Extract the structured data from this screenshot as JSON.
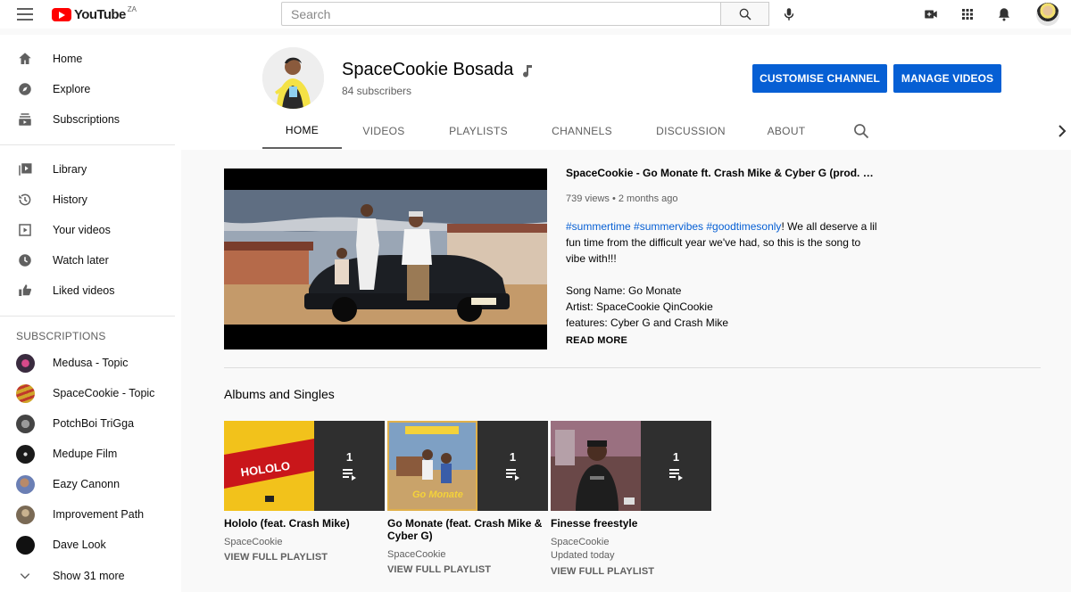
{
  "topbar": {
    "logo_text": "YouTube",
    "region": "ZA",
    "search_placeholder": "Search"
  },
  "sidebar": {
    "main": [
      {
        "label": "Home",
        "icon": "home-icon"
      },
      {
        "label": "Explore",
        "icon": "compass-icon"
      },
      {
        "label": "Subscriptions",
        "icon": "subscriptions-icon"
      }
    ],
    "library": [
      {
        "label": "Library",
        "icon": "library-icon"
      },
      {
        "label": "History",
        "icon": "history-icon"
      },
      {
        "label": "Your videos",
        "icon": "your-videos-icon"
      },
      {
        "label": "Watch later",
        "icon": "clock-icon"
      },
      {
        "label": "Liked videos",
        "icon": "thumbs-up-icon"
      }
    ],
    "subscriptions_heading": "SUBSCRIPTIONS",
    "subscriptions": [
      {
        "label": "Medusa - Topic",
        "color": "#3a2b3f"
      },
      {
        "label": "SpaceCookie - Topic",
        "color": "#d0a52a"
      },
      {
        "label": "PotchBoi TriGga",
        "color": "#555555"
      },
      {
        "label": "Medupe Film",
        "color": "#1a1a1a"
      },
      {
        "label": "Eazy Canonn",
        "color": "#6b7fb4"
      },
      {
        "label": "Improvement Path",
        "color": "#7a6a55"
      },
      {
        "label": "Dave Look",
        "color": "#111111"
      }
    ],
    "show_more": "Show 31 more"
  },
  "channel": {
    "name": "SpaceCookie Bosada",
    "subscribers": "84 subscribers",
    "customise_label": "CUSTOMISE CHANNEL",
    "manage_label": "MANAGE VIDEOS",
    "accent": "#065fd4",
    "tabs": [
      "HOME",
      "VIDEOS",
      "PLAYLISTS",
      "CHANNELS",
      "DISCUSSION",
      "ABOUT"
    ]
  },
  "featured": {
    "title": "SpaceCookie - Go Monate ft. Crash Mike & Cyber G (prod. by 8...",
    "meta": "739 views • 2 months ago",
    "tags": "#summertime #summervibes #goodtimesonly",
    "desc_after_tags": "! We all deserve a lil fun time from the difficult year we've had, so this is the song to vibe with!!!",
    "song_name": "Song Name: Go Monate",
    "artist": "Artist: SpaceCookie QinCookie",
    "features": "features: Cyber G and Crash Mike",
    "read_more": "READ MORE"
  },
  "albums_section": {
    "title": "Albums and Singles",
    "items": [
      {
        "count": "1",
        "title": "Hololo (feat. Crash Mike)",
        "channel": "SpaceCookie",
        "updated": "",
        "link": "VIEW FULL PLAYLIST",
        "art_text": "HOLOLO"
      },
      {
        "count": "1",
        "title": "Go Monate (feat. Crash Mike & Cyber G)",
        "channel": "SpaceCookie",
        "updated": "",
        "link": "VIEW FULL PLAYLIST",
        "art_text": "Go Monate"
      },
      {
        "count": "1",
        "title": "Finesse freestyle",
        "channel": "SpaceCookie",
        "updated": "Updated today",
        "link": "VIEW FULL PLAYLIST",
        "art_text": ""
      }
    ]
  }
}
